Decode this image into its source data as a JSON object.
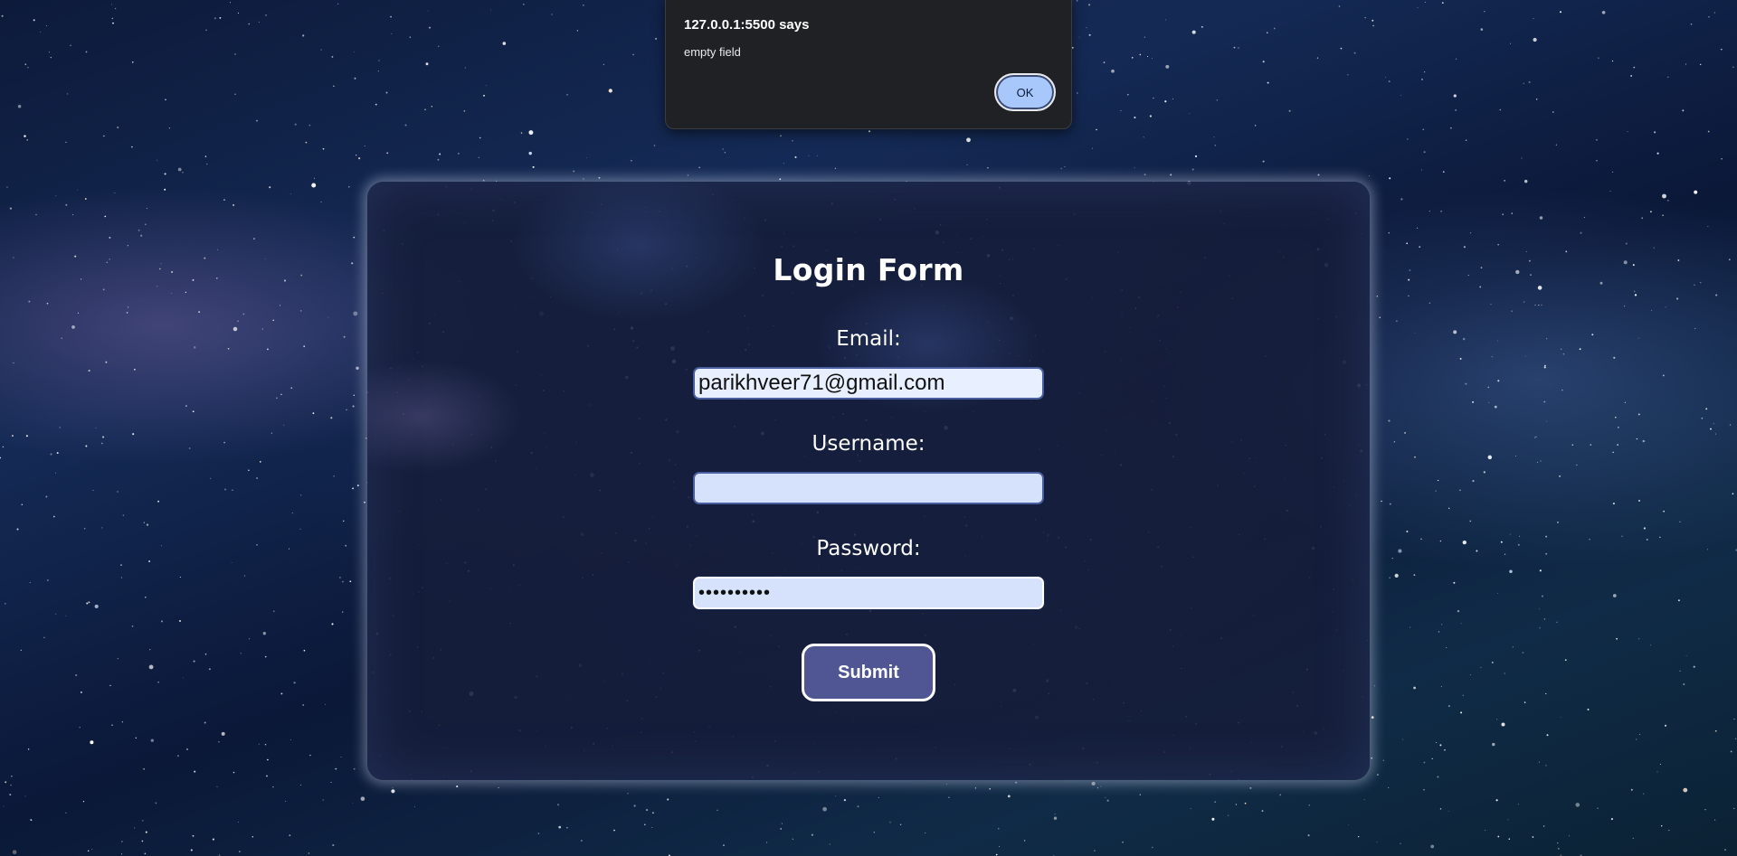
{
  "dialog": {
    "title": "127.0.0.1:5500 says",
    "message": "empty field",
    "ok_label": "OK"
  },
  "form": {
    "title": "Login Form",
    "email_label": "Email:",
    "email_value": "parikhveer71@gmail.com",
    "username_label": "Username:",
    "username_value": "",
    "password_label": "Password:",
    "password_mask": "••••••••••",
    "submit_label": "Submit"
  },
  "colors": {
    "card_background": "#161e3a",
    "input_background": "#d6e1fb",
    "submit_background": "#505694",
    "dialog_background": "#202124",
    "ok_button": "#a8c7fa"
  }
}
